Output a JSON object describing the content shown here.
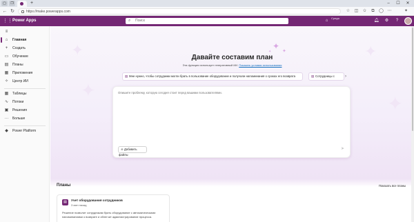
{
  "browser": {
    "url": "https://make.powerapps.com",
    "new_tab_symbol": "+",
    "window_controls": [
      "–",
      "☐",
      "✕"
    ]
  },
  "appbar": {
    "title": "Power Apps",
    "search_placeholder": "Поиск",
    "environment_label": "Среда",
    "environment_name": ""
  },
  "sidebar": {
    "items": [
      {
        "label": "Главная",
        "icon": "home-icon",
        "glyph": "⌂"
      },
      {
        "label": "Создать",
        "icon": "plus-icon",
        "glyph": "+"
      },
      {
        "label": "Обучение",
        "icon": "book-icon",
        "glyph": "▭"
      },
      {
        "label": "Планы",
        "icon": "plan-icon",
        "glyph": "▤"
      },
      {
        "label": "Приложения",
        "icon": "apps-icon",
        "glyph": "▦"
      },
      {
        "label": "Центр ИИ",
        "icon": "ai-hub-icon",
        "glyph": "✧"
      },
      {
        "label": "Таблицы",
        "icon": "table-icon",
        "glyph": "▦"
      },
      {
        "label": "Потоки",
        "icon": "flow-icon",
        "glyph": "∿"
      },
      {
        "label": "Решения",
        "icon": "solutions-icon",
        "glyph": "▣"
      },
      {
        "label": "Больше",
        "icon": "more-icon",
        "glyph": "···"
      },
      {
        "label": "Power Platform",
        "icon": "power-platform-icon",
        "glyph": "◆"
      }
    ]
  },
  "main": {
    "heading": "Давайте составим план",
    "subline_text": "Эта функция использует генеративный ИИ.",
    "subline_link": "Показать условия использования",
    "suggestions": [
      "Мне нужно, чтобы сотрудники могли брать в пользование оборудование и получали напоминания о сроках его возврата",
      "Сотрудницы с"
    ],
    "prompt_placeholder": "Опишите проблему, которую сегодня стоит перед вашими пользователями.",
    "add_files_label": "Добавить файлы",
    "plans_title": "Планы",
    "show_all_label": "Показать все планы",
    "plan": {
      "name": "Учет оборудования сотрудников",
      "date": "3 мин назад",
      "description": "Решение позволит сотрудникам брать оборудование с автоматическими напоминаниями о возврате и облегчит администрирование процесса."
    }
  },
  "colors": {
    "brand": "#742774",
    "link": "#0f6cbd"
  }
}
